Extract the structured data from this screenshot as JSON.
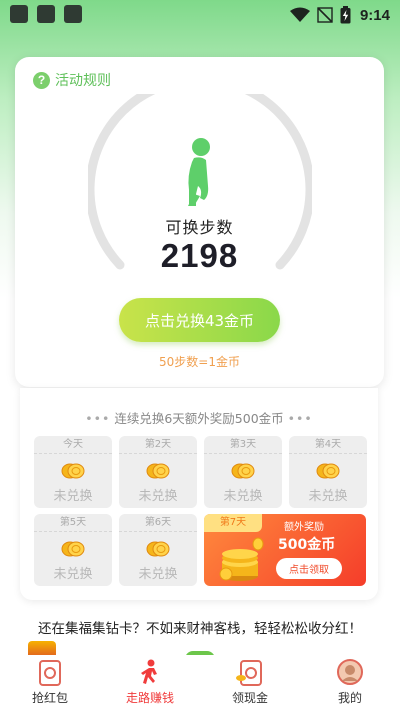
{
  "status_bar": {
    "time": "9:14",
    "icons": [
      "app-icon",
      "app-icon",
      "app-icon",
      "wifi-icon",
      "no-signal-icon",
      "battery-charging-icon"
    ]
  },
  "activity": {
    "rules_label": "活动规则",
    "steps_label": "可换步数",
    "steps_value": "2198",
    "exchange_button": "点击兑换43金币",
    "rate": "50步数=1金币"
  },
  "streak": {
    "title": "连续兑换6天额外奖励500金币",
    "days": [
      {
        "label": "今天",
        "status": "未兑换"
      },
      {
        "label": "第2天",
        "status": "未兑换"
      },
      {
        "label": "第3天",
        "status": "未兑换"
      },
      {
        "label": "第4天",
        "status": "未兑换"
      },
      {
        "label": "第5天",
        "status": "未兑换"
      },
      {
        "label": "第6天",
        "status": "未兑换"
      }
    ],
    "bonus": {
      "day_label": "第7天",
      "label": "额外奖励",
      "amount": "500金币",
      "button": "点击领取"
    }
  },
  "promo_text": "还在集福集钻卡？不如来财神客栈，轻轻松松收分红！",
  "bottom_nav": [
    {
      "label": "抢红包",
      "icon": "red-envelope-icon",
      "active": false
    },
    {
      "label": "走路赚钱",
      "icon": "walking-person-icon",
      "active": true
    },
    {
      "label": "领现金",
      "icon": "cash-card-icon",
      "active": false
    },
    {
      "label": "我的",
      "icon": "avatar-icon",
      "active": false
    }
  ],
  "colors": {
    "accent_green": "#7ccf6c",
    "button_gradient_start": "#c9e34a",
    "button_gradient_end": "#8ad84a",
    "rate_orange": "#f0a050",
    "bonus_red": "#f53d2a",
    "nav_active": "#f03c3c"
  }
}
